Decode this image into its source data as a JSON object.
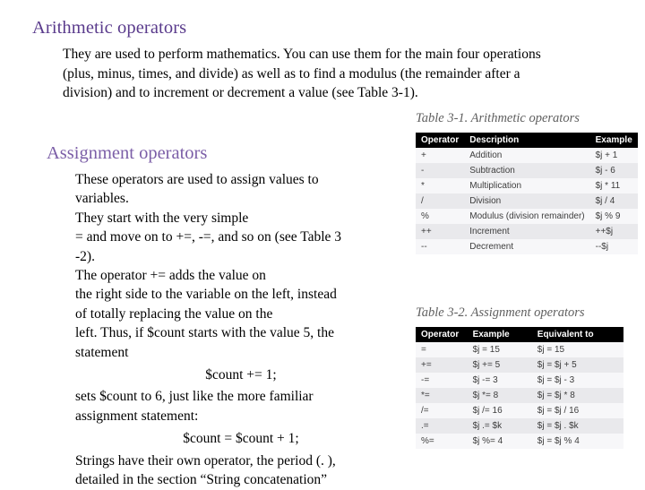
{
  "headings": {
    "arithmetic": "Arithmetic operators",
    "assignment": "Assignment operators"
  },
  "paragraphs": {
    "arithmetic_body": "They are used to perform mathematics. You can use them for the main four operations (plus, minus, times, and divide) as well as to find a modulus (the remainder after a division) and to increment or decrement a value (see Table 3-1).",
    "assignment_lines": [
      "These operators are used to assign values to",
      "variables.",
      "They start with the very simple",
      "= and move on to +=, -=, and so on (see Table 3",
      "-2).",
      "The operator += adds the value on",
      "the right side to the variable on the left, instead",
      "of totally replacing the value on the",
      "left. Thus, if $count starts with the value 5, the",
      "statement"
    ],
    "code1": "$count += 1;",
    "after_code1_lines": [
      "sets $count to 6, just like the more familiar",
      "assignment statement:"
    ],
    "code2": "$count = $count + 1;",
    "tail_lines": [
      "Strings have their own operator, the period (. ),",
      "detailed in the section “String concatenation”"
    ]
  },
  "table31": {
    "caption": "Table 3-1. Arithmetic operators",
    "headers": [
      "Operator",
      "Description",
      "Example"
    ],
    "rows": [
      [
        "+",
        "Addition",
        "$j + 1"
      ],
      [
        "-",
        "Subtraction",
        "$j - 6"
      ],
      [
        "*",
        "Multiplication",
        "$j * 11"
      ],
      [
        "/",
        "Division",
        "$j / 4"
      ],
      [
        "%",
        "Modulus (division remainder)",
        "$j % 9"
      ],
      [
        "++",
        "Increment",
        "++$j"
      ],
      [
        "--",
        "Decrement",
        "--$j"
      ]
    ]
  },
  "table32": {
    "caption": "Table 3-2. Assignment operators",
    "headers": [
      "Operator",
      "Example",
      "Equivalent to"
    ],
    "rows": [
      [
        "=",
        "$j = 15",
        "$j = 15"
      ],
      [
        "+=",
        "$j += 5",
        "$j = $j + 5"
      ],
      [
        "-=",
        "$j -= 3",
        "$j = $j - 3"
      ],
      [
        "*=",
        "$j *= 8",
        "$j = $j * 8"
      ],
      [
        "/=",
        "$j /= 16",
        "$j = $j / 16"
      ],
      [
        ".=",
        "$j .= $k",
        "$j = $j . $k"
      ],
      [
        "%=",
        "$j %= 4",
        "$j = $j % 4"
      ]
    ]
  },
  "colors": {
    "heading_purple": "#5a3b8c",
    "heading_purple_light": "#7b5ea7",
    "table_header_bg": "#000000",
    "table_row_alt": "#e9e9ec",
    "table_row_norm": "#f7f7f9",
    "caption_gray": "#5f5f5f"
  }
}
